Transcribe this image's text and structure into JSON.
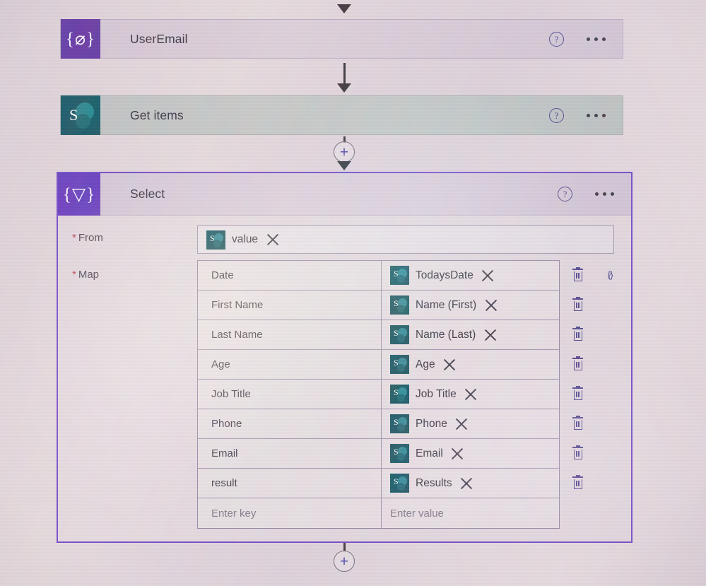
{
  "app": {
    "name": "Power Automate flow designer",
    "accent_purple": "#6b3fc4",
    "sharepoint_teal": "#0d4d59",
    "compose_purple": "#5b2d9e",
    "required_star_color": "#b7384a"
  },
  "flow": {
    "steps": [
      {
        "id": "useremail",
        "title": "UserEmail",
        "icon": "compose-icon",
        "icon_glyph": "{⌀}",
        "help_label": "?",
        "menu_label": "⋯"
      },
      {
        "id": "getitems",
        "title": "Get items",
        "icon": "sharepoint-icon",
        "icon_glyph": "S",
        "help_label": "?",
        "menu_label": "⋯"
      }
    ],
    "insert_button_label": "+"
  },
  "select_card": {
    "title": "Select",
    "icon": "select-filter-icon",
    "icon_glyph": "{▽}",
    "help_label": "?",
    "menu_label": "⋯",
    "from": {
      "label": "From",
      "required_marker": "*",
      "token": {
        "icon": "sharepoint-token-icon",
        "icon_letter": "S",
        "label": "value",
        "remove_label": "✕"
      }
    },
    "map": {
      "label": "Map",
      "required_marker": "*",
      "key_placeholder": "Enter key",
      "value_placeholder": "Enter value",
      "expression_icon_label": "⟨∕⟩",
      "delete_label": "Delete",
      "rows": [
        {
          "key": "Date",
          "value": "TodaysDate",
          "value_icon_letter": "S",
          "remove_label": "✕",
          "has_expression_toggle": true
        },
        {
          "key": "First Name",
          "value": "Name (First)",
          "value_icon_letter": "S",
          "remove_label": "✕",
          "has_expression_toggle": false
        },
        {
          "key": "Last Name",
          "value": "Name (Last)",
          "value_icon_letter": "S",
          "remove_label": "✕",
          "has_expression_toggle": false
        },
        {
          "key": "Age",
          "value": "Age",
          "value_icon_letter": "S",
          "remove_label": "✕",
          "has_expression_toggle": false
        },
        {
          "key": "Job Title",
          "value": "Job Title",
          "value_icon_letter": "S",
          "remove_label": "✕",
          "has_expression_toggle": false
        },
        {
          "key": "Phone",
          "value": "Phone",
          "value_icon_letter": "S",
          "remove_label": "✕",
          "has_expression_toggle": false
        },
        {
          "key": "Email",
          "value": "Email",
          "value_icon_letter": "S",
          "remove_label": "✕",
          "has_expression_toggle": false
        },
        {
          "key": "result",
          "value": "Results",
          "value_icon_letter": "S",
          "remove_label": "✕",
          "has_expression_toggle": false
        }
      ]
    }
  },
  "bottom": {
    "insert_button_label": "+"
  }
}
